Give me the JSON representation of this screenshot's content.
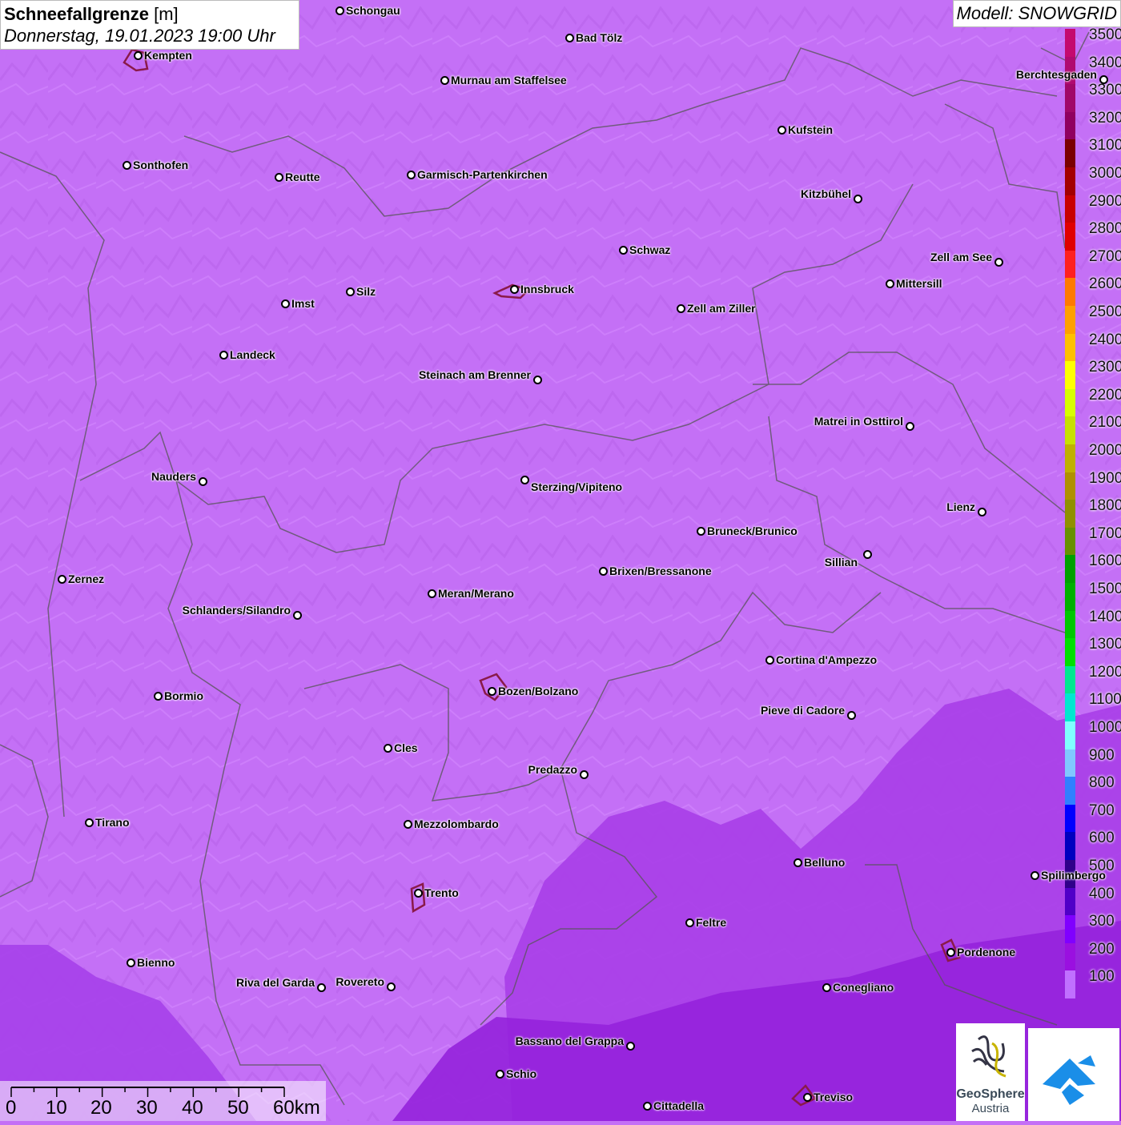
{
  "title": {
    "label": "Schneefallgrenze",
    "unit": "[m]",
    "datetime": "Donnerstag, 19.01.2023 19:00 Uhr"
  },
  "model_label": "Modell: SNOWGRID",
  "legend": {
    "ticks": [
      "3500",
      "3400",
      "3300",
      "3200",
      "3100",
      "3000",
      "2900",
      "2800",
      "2700",
      "2600",
      "2500",
      "2400",
      "2300",
      "2200",
      "2100",
      "2000",
      "1900",
      "1800",
      "1700",
      "1600",
      "1500",
      "1400",
      "1300",
      "1200",
      "1100",
      "1000",
      "900",
      "800",
      "700",
      "600",
      "500",
      "400",
      "300",
      "200",
      "100"
    ],
    "colors": [
      "#c40a6e",
      "#b00a70",
      "#a00868",
      "#900060",
      "#7a0000",
      "#a30000",
      "#c80000",
      "#e00000",
      "#ff2020",
      "#ff7a00",
      "#ffa000",
      "#ffc000",
      "#ffff00",
      "#d8ff00",
      "#c8e000",
      "#c0b000",
      "#b09000",
      "#909000",
      "#689000",
      "#00a000",
      "#00b000",
      "#00c800",
      "#00e000",
      "#00e890",
      "#00e8d0",
      "#80ffff",
      "#80c8ff",
      "#3080ff",
      "#0000ff",
      "#0000c0",
      "#30008a",
      "#5000c8",
      "#8000ff",
      "#9a10e0",
      "#c070ff"
    ]
  },
  "cities": [
    {
      "name": "Schongau"
    },
    {
      "name": "Bad Tölz"
    },
    {
      "name": "Kempten"
    },
    {
      "name": "Murnau am Staffelsee"
    },
    {
      "name": "Berchtesgaden"
    },
    {
      "name": "Kufstein"
    },
    {
      "name": "Sonthofen"
    },
    {
      "name": "Reutte"
    },
    {
      "name": "Garmisch-Partenkirchen"
    },
    {
      "name": "Kitzbühel"
    },
    {
      "name": "Schwaz"
    },
    {
      "name": "Zell am See"
    },
    {
      "name": "Mittersill"
    },
    {
      "name": "Innsbruck"
    },
    {
      "name": "Imst"
    },
    {
      "name": "Silz"
    },
    {
      "name": "Zell am Ziller"
    },
    {
      "name": "Landeck"
    },
    {
      "name": "Steinach am Brenner"
    },
    {
      "name": "Matrei in Osttirol"
    },
    {
      "name": "Nauders"
    },
    {
      "name": "Sterzing/Vipiteno"
    },
    {
      "name": "Lienz"
    },
    {
      "name": "Bruneck/Brunico"
    },
    {
      "name": "Sillian"
    },
    {
      "name": "Brixen/Bressanone"
    },
    {
      "name": "Zernez"
    },
    {
      "name": "Meran/Merano"
    },
    {
      "name": "Schlanders/Silandro"
    },
    {
      "name": "Cortina d'Ampezzo"
    },
    {
      "name": "Bozen/Bolzano"
    },
    {
      "name": "Bormio"
    },
    {
      "name": "Pieve di Cadore"
    },
    {
      "name": "Cles"
    },
    {
      "name": "Predazzo"
    },
    {
      "name": "Tirano"
    },
    {
      "name": "Mezzolombardo"
    },
    {
      "name": "Belluno"
    },
    {
      "name": "Spilimbergo"
    },
    {
      "name": "Trento"
    },
    {
      "name": "Feltre"
    },
    {
      "name": "Pordenone"
    },
    {
      "name": "Bienno"
    },
    {
      "name": "Riva del Garda"
    },
    {
      "name": "Rovereto"
    },
    {
      "name": "Conegliano"
    },
    {
      "name": "Bassano del Grappa"
    },
    {
      "name": "Schio"
    },
    {
      "name": "Treviso"
    },
    {
      "name": "Cittadella"
    }
  ],
  "scale_bar": {
    "ticks": [
      "0",
      "10",
      "20",
      "30",
      "40",
      "50",
      "60km"
    ]
  },
  "logos": {
    "geosphere_line1": "GeoSphere",
    "geosphere_line2": "Austria"
  }
}
